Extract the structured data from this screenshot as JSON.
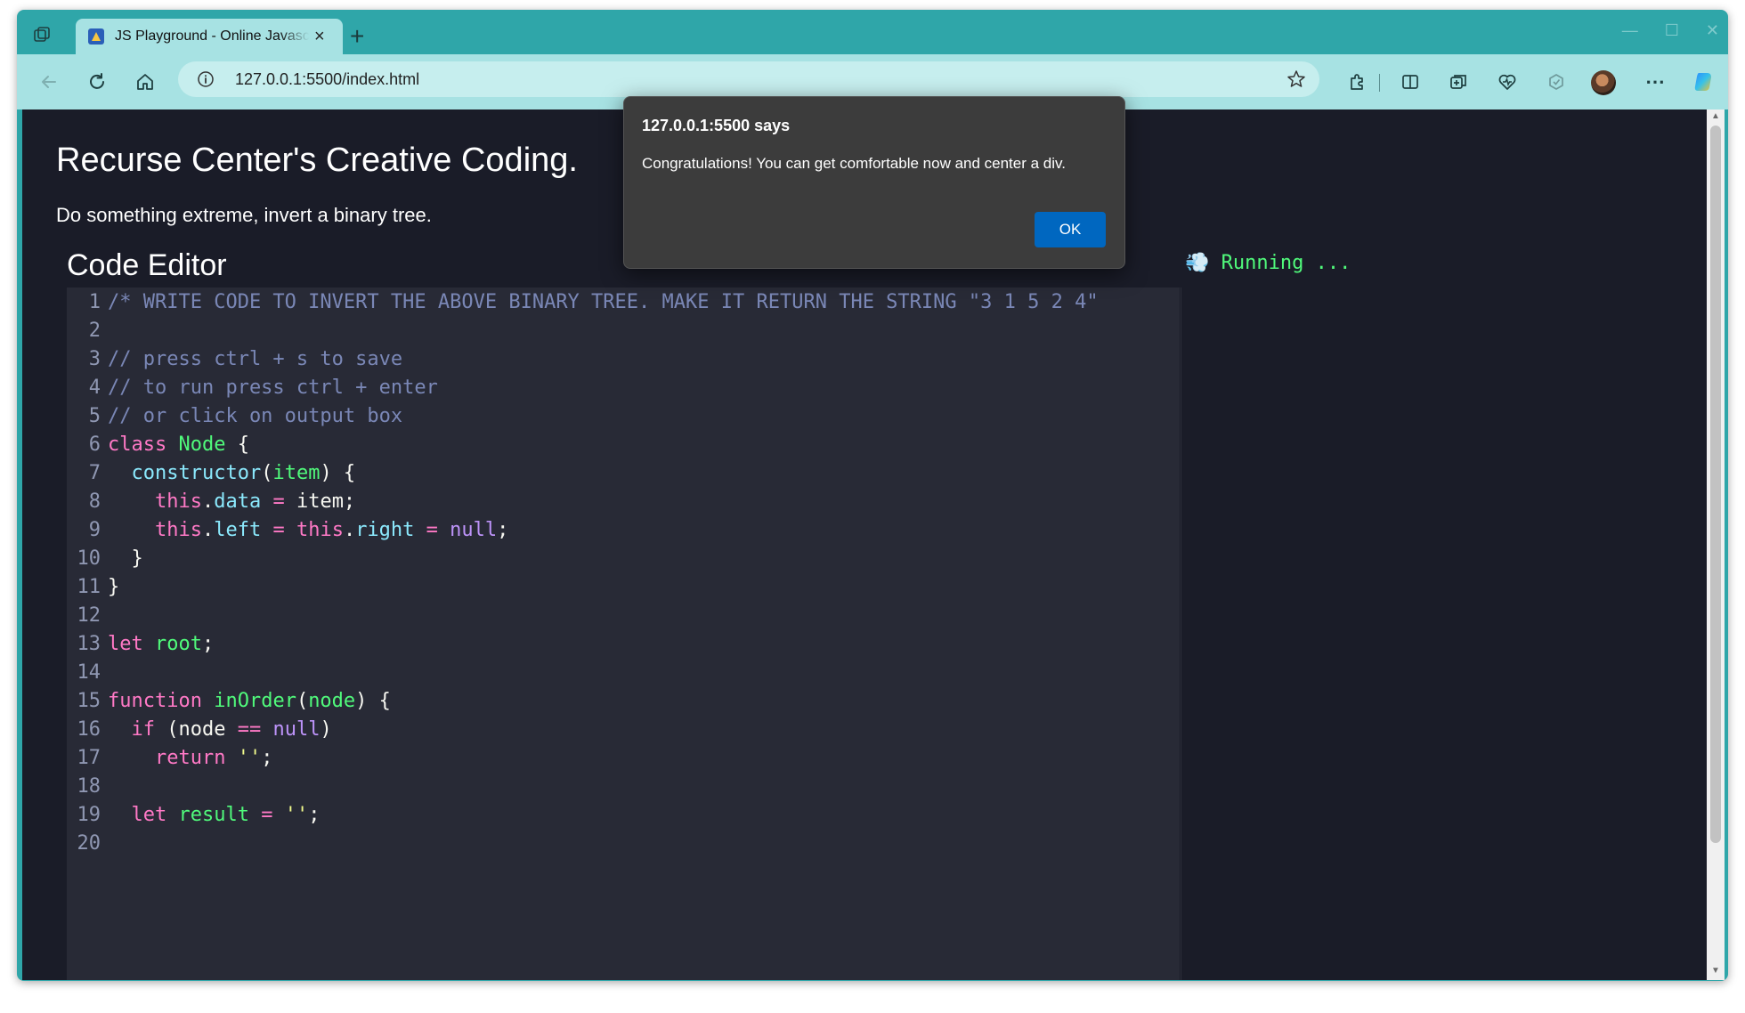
{
  "browser": {
    "tab_title": "JS Playground - Online Javascript Editor",
    "new_tab_label": "+",
    "close_tab_label": "×",
    "url": "127.0.0.1:5500/index.html",
    "accent_color": "#2fa6a9"
  },
  "page": {
    "title": "Recurse Center's Creative Coding.",
    "subtitle": "Do something extreme, invert a binary tree.",
    "editor_heading": "Code Editor",
    "output_status": "Running ...",
    "output_emoji": "💨"
  },
  "code_lines": [
    {
      "n": "1",
      "tokens": [
        [
          "c-comment",
          "/* WRITE CODE TO INVERT THE ABOVE BINARY TREE. MAKE IT RETURN THE STRING \"3 1 5 2 4\""
        ]
      ]
    },
    {
      "n": "2",
      "tokens": []
    },
    {
      "n": "3",
      "tokens": [
        [
          "c-comment",
          "// press ctrl + s to save"
        ]
      ]
    },
    {
      "n": "4",
      "tokens": [
        [
          "c-comment",
          "// to run press ctrl + enter"
        ]
      ]
    },
    {
      "n": "5",
      "tokens": [
        [
          "c-comment",
          "// or click on output box"
        ]
      ]
    },
    {
      "n": "6",
      "tokens": [
        [
          "c-kw",
          "class "
        ],
        [
          "c-cls",
          "Node"
        ],
        [
          "c-plain",
          " {"
        ]
      ]
    },
    {
      "n": "7",
      "tokens": [
        [
          "c-plain",
          "  "
        ],
        [
          "c-fn",
          "constructor"
        ],
        [
          "c-plain",
          "("
        ],
        [
          "c-var",
          "item"
        ],
        [
          "c-plain",
          ") {"
        ]
      ]
    },
    {
      "n": "8",
      "tokens": [
        [
          "c-plain",
          "    "
        ],
        [
          "c-kw",
          "this"
        ],
        [
          "c-plain",
          "."
        ],
        [
          "c-prop",
          "data"
        ],
        [
          "c-op",
          " = "
        ],
        [
          "c-plain",
          "item;"
        ]
      ]
    },
    {
      "n": "9",
      "tokens": [
        [
          "c-plain",
          "    "
        ],
        [
          "c-kw",
          "this"
        ],
        [
          "c-plain",
          "."
        ],
        [
          "c-prop",
          "left"
        ],
        [
          "c-op",
          " = "
        ],
        [
          "c-kw",
          "this"
        ],
        [
          "c-plain",
          "."
        ],
        [
          "c-prop",
          "right"
        ],
        [
          "c-op",
          " = "
        ],
        [
          "c-null",
          "null"
        ],
        [
          "c-plain",
          ";"
        ]
      ]
    },
    {
      "n": "10",
      "tokens": [
        [
          "c-plain",
          "  }"
        ]
      ]
    },
    {
      "n": "11",
      "tokens": [
        [
          "c-plain",
          "}"
        ]
      ]
    },
    {
      "n": "12",
      "tokens": []
    },
    {
      "n": "13",
      "tokens": [
        [
          "c-kw",
          "let "
        ],
        [
          "c-var",
          "root"
        ],
        [
          "c-plain",
          ";"
        ]
      ]
    },
    {
      "n": "14",
      "tokens": []
    },
    {
      "n": "15",
      "tokens": [
        [
          "c-kw",
          "function "
        ],
        [
          "c-cls",
          "inOrder"
        ],
        [
          "c-plain",
          "("
        ],
        [
          "c-var",
          "node"
        ],
        [
          "c-plain",
          ") {"
        ]
      ]
    },
    {
      "n": "16",
      "tokens": [
        [
          "c-plain",
          "  "
        ],
        [
          "c-kw",
          "if"
        ],
        [
          "c-plain",
          " (node "
        ],
        [
          "c-op",
          "=="
        ],
        [
          "c-plain",
          " "
        ],
        [
          "c-null",
          "null"
        ],
        [
          "c-plain",
          ")"
        ]
      ]
    },
    {
      "n": "17",
      "tokens": [
        [
          "c-plain",
          "    "
        ],
        [
          "c-kw",
          "return"
        ],
        [
          "c-plain",
          " "
        ],
        [
          "c-str",
          "''"
        ],
        [
          "c-plain",
          ";"
        ]
      ]
    },
    {
      "n": "18",
      "tokens": []
    },
    {
      "n": "19",
      "tokens": [
        [
          "c-plain",
          "  "
        ],
        [
          "c-kw",
          "let "
        ],
        [
          "c-var",
          "result"
        ],
        [
          "c-op",
          " = "
        ],
        [
          "c-str",
          "''"
        ],
        [
          "c-plain",
          ";"
        ]
      ]
    },
    {
      "n": "20",
      "tokens": []
    }
  ],
  "dialog": {
    "title": "127.0.0.1:5500 says",
    "message": "Congratulations! You can get comfortable now and center a div.",
    "ok_label": "OK"
  }
}
